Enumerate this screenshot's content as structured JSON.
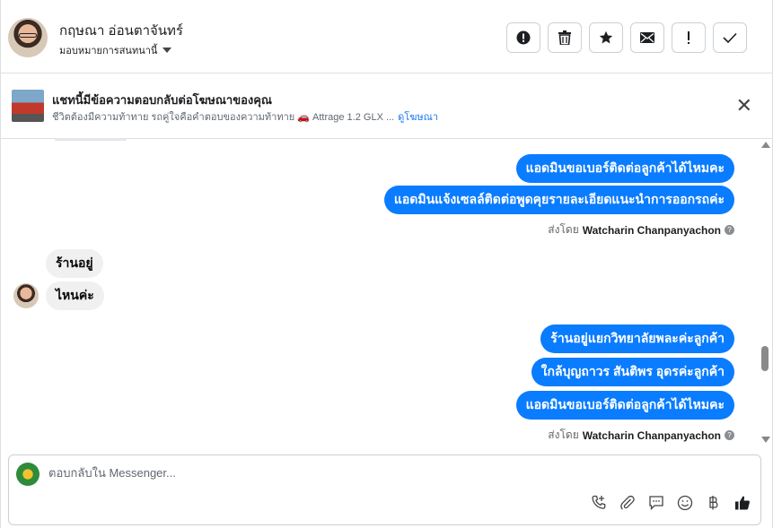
{
  "header": {
    "contact_name": "กฤษณา อ่อนตาจันทร์",
    "assign_label": "มอบหมายการสนทนานี้",
    "actions": [
      {
        "name": "spam-button",
        "icon": "alert-circle-icon",
        "glyph": "!"
      },
      {
        "name": "delete-button",
        "icon": "trash-icon",
        "glyph": "🗑"
      },
      {
        "name": "star-button",
        "icon": "star-icon",
        "glyph": "★"
      },
      {
        "name": "mark-unread-button",
        "icon": "envelope-icon",
        "glyph": "✉"
      },
      {
        "name": "follow-up-button",
        "icon": "exclamation-icon",
        "glyph": "!"
      },
      {
        "name": "done-button",
        "icon": "check-icon",
        "glyph": "✓"
      }
    ]
  },
  "ad": {
    "title": "แชทนี้มีข้อความตอบกลับต่อโฆษณาของคุณ",
    "subtitle": "ชีวิตต้องมีความท้าทาย รถคู่ใจคือคำตอบของความท้าทาย 🚗 Attrage 1.2 GLX ...",
    "link_label": "ดูโฆษณา",
    "close_glyph": "✕"
  },
  "messages": [
    {
      "dir": "out",
      "text": "แอดมินขอเบอร์ติดต่อลูกค้าได้ไหมคะ"
    },
    {
      "dir": "out",
      "text": "แอดมินแจ้งเซลล์ติดต่อพูดคุยรายละเอียดแนะนำการออกรถค่ะ"
    },
    {
      "dir": "meta",
      "prefix": "ส่งโดย",
      "sender": "Watcharin Chanpanyachon"
    },
    {
      "dir": "in",
      "text": "ร้านอยู่"
    },
    {
      "dir": "in",
      "text": "ไหนค่ะ"
    },
    {
      "dir": "out",
      "text": "ร้านอยู่แยกวิทยาลัยพละค่ะลูกค้า"
    },
    {
      "dir": "out",
      "text": "ใกล้บุญถาวร สันติพร อุดรค่ะลูกค้า"
    },
    {
      "dir": "out",
      "text": "แอดมินขอเบอร์ติดต่อลูกค้าได้ไหมคะ"
    },
    {
      "dir": "meta",
      "prefix": "ส่งโดย",
      "sender": "Watcharin Chanpanyachon"
    }
  ],
  "composer": {
    "placeholder": "ตอบกลับใน Messenger...",
    "tools": [
      {
        "name": "call-add-icon",
        "glyph": "✆"
      },
      {
        "name": "attachment-icon",
        "glyph": "📎"
      },
      {
        "name": "saved-replies-icon",
        "glyph": "💬"
      },
      {
        "name": "emoji-icon",
        "glyph": "☺"
      },
      {
        "name": "payment-icon",
        "glyph": "฿"
      },
      {
        "name": "like-icon",
        "glyph": "👍"
      }
    ]
  },
  "colors": {
    "outgoing_bubble": "#0a7cff",
    "incoming_bubble": "#f0f0f0",
    "link": "#1877f2"
  }
}
